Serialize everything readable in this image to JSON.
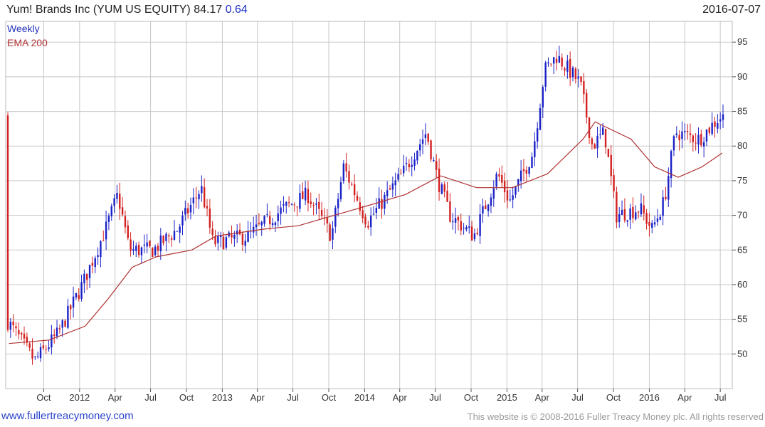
{
  "header": {
    "company": "Yum! Brands Inc (YUM US EQUITY)",
    "last_price": "84.17",
    "change": "0.64",
    "date": "2016-07-07"
  },
  "legend": {
    "weekly": "Weekly",
    "ema": "EMA 200"
  },
  "footer": {
    "site": "www.fullertreacymoney.com",
    "copyright": "This website is © 2008-2016 Fuller Treacy Money plc. All rights reserved"
  },
  "colors": {
    "up": "#1a22c8",
    "down": "#d42020",
    "ema": "#b03030",
    "grid": "#c8c8c8"
  },
  "chart_data": {
    "type": "candlestick",
    "frequency": "weekly",
    "ylim": [
      45,
      98
    ],
    "y_ticks": [
      50,
      55,
      60,
      65,
      70,
      75,
      80,
      85,
      90,
      95
    ],
    "y_axis_side": "right",
    "grid": true,
    "x_tick_labels": [
      "Oct",
      "2012",
      "Apr",
      "Jul",
      "Oct",
      "2013",
      "Apr",
      "Jul",
      "Oct",
      "2014",
      "Apr",
      "Jul",
      "Oct",
      "2015",
      "Apr",
      "Jul",
      "Oct",
      "2016",
      "Apr",
      "Jul"
    ],
    "series": [
      {
        "name": "Weekly",
        "style": "candles"
      },
      {
        "name": "EMA 200",
        "style": "line"
      }
    ],
    "key_points": [
      {
        "date": "2011-07",
        "close": 55
      },
      {
        "date": "2011-09",
        "close": 49
      },
      {
        "date": "2011-11",
        "close": 53
      },
      {
        "date": "2012-01",
        "close": 60
      },
      {
        "date": "2012-03",
        "close": 68
      },
      {
        "date": "2012-04",
        "close": 73
      },
      {
        "date": "2012-05",
        "close": 65
      },
      {
        "date": "2012-07",
        "close": 65
      },
      {
        "date": "2012-09",
        "close": 68
      },
      {
        "date": "2012-11",
        "close": 74
      },
      {
        "date": "2012-12",
        "close": 66
      },
      {
        "date": "2013-03",
        "close": 67
      },
      {
        "date": "2013-06",
        "close": 71
      },
      {
        "date": "2013-08",
        "close": 73
      },
      {
        "date": "2013-10",
        "close": 67
      },
      {
        "date": "2013-11",
        "close": 77
      },
      {
        "date": "2014-01",
        "close": 69
      },
      {
        "date": "2014-04",
        "close": 76
      },
      {
        "date": "2014-06",
        "close": 82
      },
      {
        "date": "2014-07",
        "close": 75
      },
      {
        "date": "2014-08",
        "close": 70
      },
      {
        "date": "2014-10",
        "close": 67
      },
      {
        "date": "2014-12",
        "close": 76
      },
      {
        "date": "2015-01",
        "close": 72
      },
      {
        "date": "2015-03",
        "close": 79
      },
      {
        "date": "2015-04",
        "close": 91
      },
      {
        "date": "2015-05",
        "close": 93
      },
      {
        "date": "2015-06",
        "close": 91
      },
      {
        "date": "2015-07",
        "close": 89
      },
      {
        "date": "2015-08",
        "close": 80
      },
      {
        "date": "2015-09",
        "close": 82
      },
      {
        "date": "2015-10",
        "close": 70
      },
      {
        "date": "2015-12",
        "close": 71
      },
      {
        "date": "2016-01",
        "close": 68
      },
      {
        "date": "2016-02",
        "close": 72
      },
      {
        "date": "2016-03",
        "close": 82
      },
      {
        "date": "2016-05",
        "close": 81
      },
      {
        "date": "2016-07",
        "close": 84.17
      }
    ],
    "ema_points": [
      {
        "date": "2011-07",
        "value": 51.5
      },
      {
        "date": "2011-10",
        "value": 52
      },
      {
        "date": "2012-01",
        "value": 54
      },
      {
        "date": "2012-03",
        "value": 58
      },
      {
        "date": "2012-05",
        "value": 62.5
      },
      {
        "date": "2012-07",
        "value": 64
      },
      {
        "date": "2012-10",
        "value": 65
      },
      {
        "date": "2012-12",
        "value": 67
      },
      {
        "date": "2013-04",
        "value": 68
      },
      {
        "date": "2013-07",
        "value": 68.5
      },
      {
        "date": "2013-10",
        "value": 70
      },
      {
        "date": "2014-01",
        "value": 71.5
      },
      {
        "date": "2014-04",
        "value": 73
      },
      {
        "date": "2014-07",
        "value": 75.7
      },
      {
        "date": "2014-10",
        "value": 74
      },
      {
        "date": "2015-01",
        "value": 74
      },
      {
        "date": "2015-04",
        "value": 76
      },
      {
        "date": "2015-07",
        "value": 81
      },
      {
        "date": "2015-08",
        "value": 83.5
      },
      {
        "date": "2015-11",
        "value": 81
      },
      {
        "date": "2016-01",
        "value": 77
      },
      {
        "date": "2016-03",
        "value": 75.5
      },
      {
        "date": "2016-05",
        "value": 77
      },
      {
        "date": "2016-07",
        "value": 79
      }
    ]
  }
}
